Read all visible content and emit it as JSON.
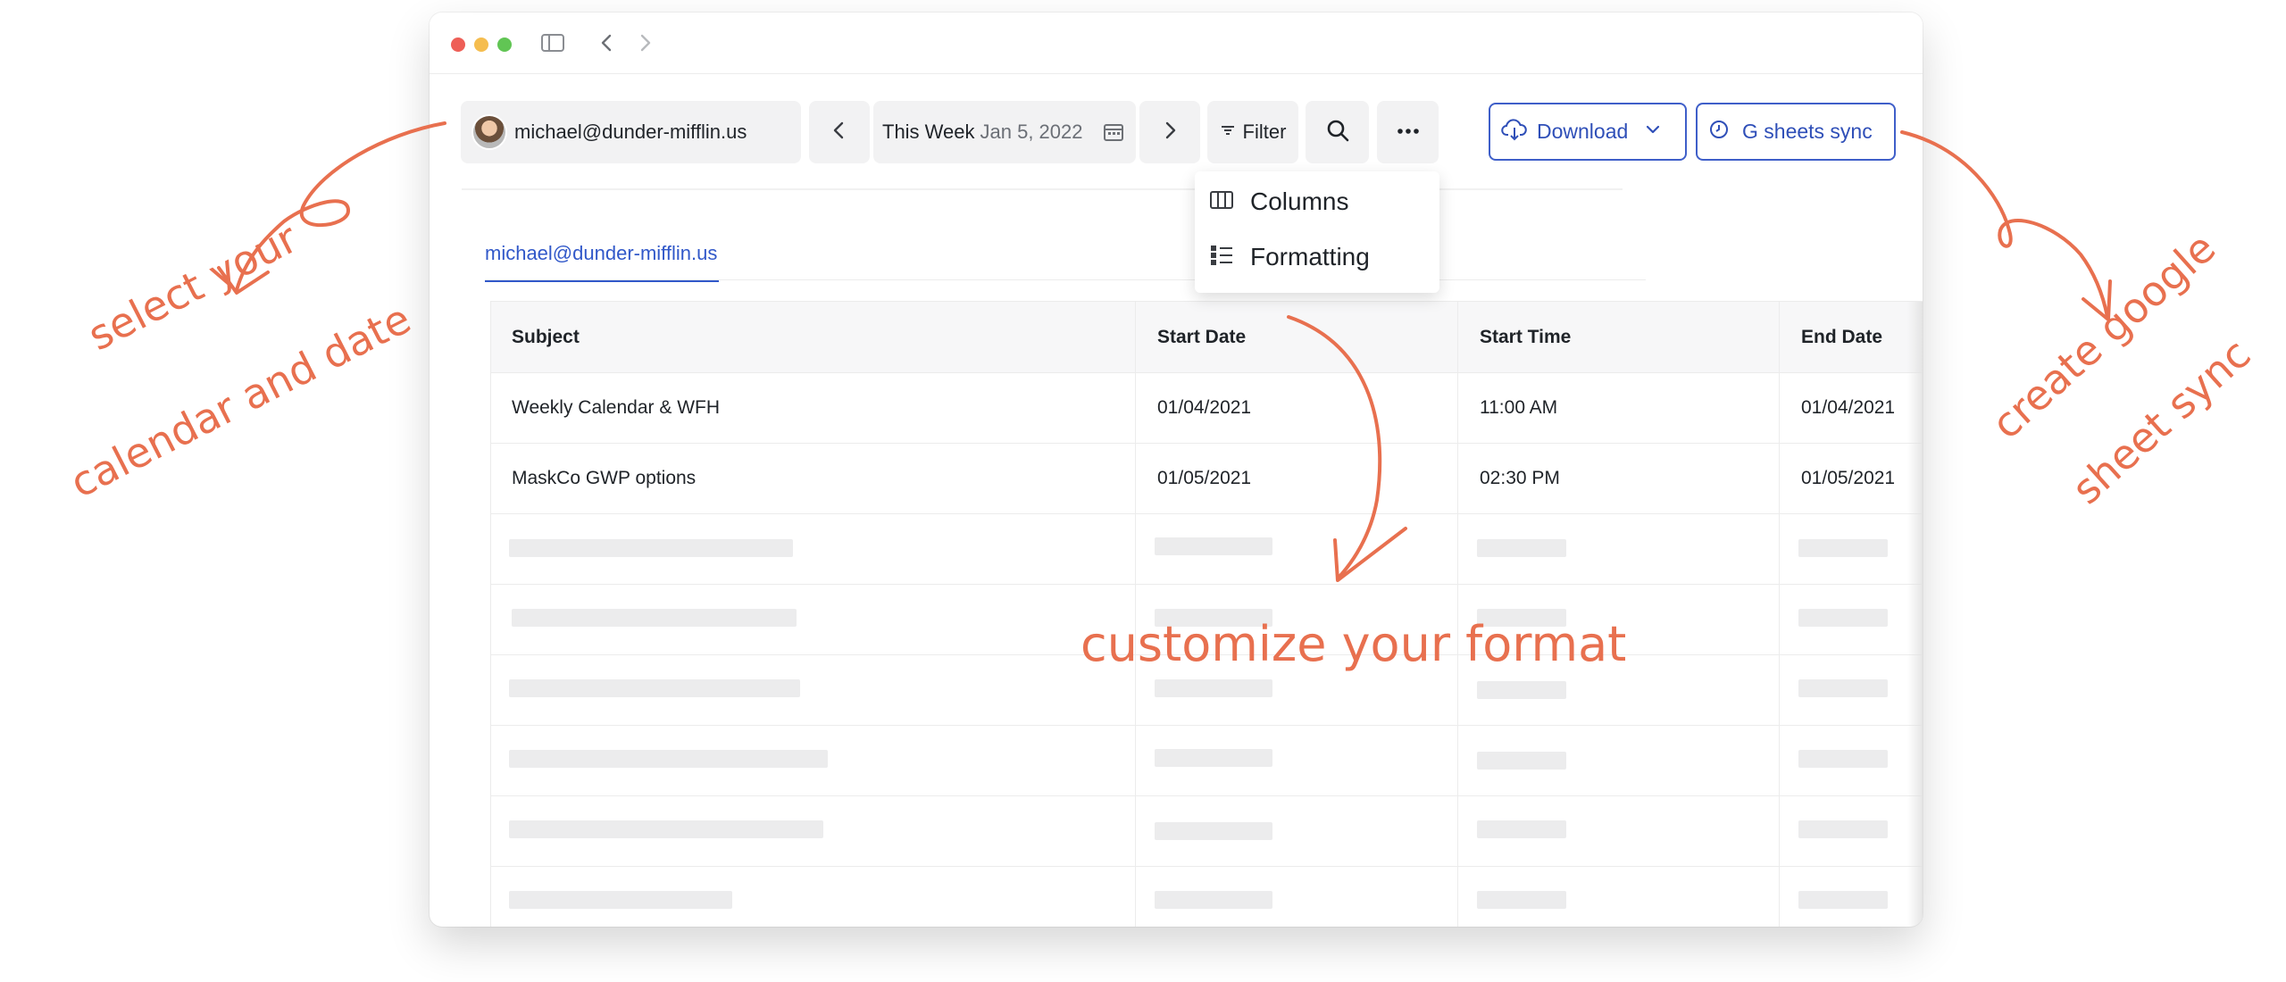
{
  "toolbar": {
    "account": "michael@dunder-mifflin.us",
    "week_label": "This Week",
    "week_date": "Jan 5, 2022",
    "filter_label": "Filter",
    "download_label": "Download",
    "gsync_label": "G sheets sync"
  },
  "menu": {
    "columns_label": "Columns",
    "formatting_label": "Formatting"
  },
  "tab": {
    "label": "michael@dunder-mifflin.us"
  },
  "table": {
    "headers": [
      "Subject",
      "Start Date",
      "Start Time",
      "End Date"
    ],
    "rows": [
      [
        "Weekly Calendar & WFH",
        "01/04/2021",
        "11:00 AM",
        "01/04/2021"
      ],
      [
        "MaskCo GWP options",
        "01/05/2021",
        "02:30 PM",
        "01/05/2021"
      ]
    ]
  },
  "annotations": {
    "left_line1": "select your",
    "left_line2": "calendar and date",
    "middle": "customize your format",
    "right_line1": "create google",
    "right_line2": "sheet sync"
  },
  "colors": {
    "accent": "#3158c9",
    "annotation": "#e8704f"
  },
  "icons": [
    "sidebar-toggle-icon",
    "back-icon",
    "forward-icon",
    "chevron-left-icon",
    "chevron-right-icon",
    "calendar-icon",
    "filter-icon",
    "search-icon",
    "more-icon",
    "cloud-download-icon",
    "chevron-down-icon",
    "clock-icon",
    "columns-icon",
    "formatting-icon"
  ]
}
